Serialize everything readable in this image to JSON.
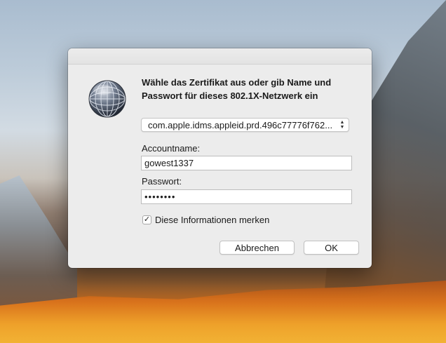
{
  "dialog": {
    "title": "Wähle das Zertifikat aus oder gib Name und Passwort für dieses 802.1X-Netzwerk ein",
    "icon": "network-globe-icon",
    "certificate": {
      "selected": "com.apple.idms.appleid.prd.496c77776f762..."
    },
    "account": {
      "label": "Accountname:",
      "value": "gowest1337"
    },
    "password": {
      "label": "Passwort:",
      "masked_value": "••••••••"
    },
    "remember": {
      "label": "Diese Informationen merken",
      "checked": true,
      "check_glyph": "✓"
    },
    "buttons": {
      "cancel": "Abbrechen",
      "ok": "OK"
    }
  }
}
